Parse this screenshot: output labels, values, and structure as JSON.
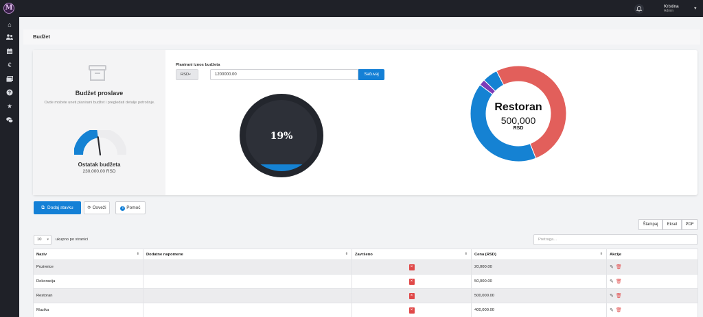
{
  "topbar": {
    "logo_letter": "M",
    "user_name": "Kristina",
    "user_role": "Admin"
  },
  "sidebar": {
    "items": [
      "home-icon",
      "users-icon",
      "calendar-icon",
      "euro-icon",
      "images-icon",
      "help-icon",
      "star-icon",
      "chat-icon"
    ]
  },
  "page": {
    "title": "Budžet"
  },
  "left": {
    "title": "Budžet proslave",
    "description": "Ovde možete uneti planirani budžet i pregledati detalje potrošnje.",
    "remaining_title": "Ostatak budžeta",
    "remaining_value": "230,000.00 RSD",
    "gauge_fraction": 0.46
  },
  "budget_form": {
    "label": "Planirani iznos budžeta",
    "currency": "RSD",
    "amount": "1200000.00",
    "save_label": "Sačuvaj"
  },
  "tank": {
    "percent_label": "19%",
    "fill_fraction": 0.19
  },
  "donut": {
    "center_name": "Restoran",
    "center_value": "500,000",
    "center_unit": "RSD",
    "segments": [
      {
        "name": "Pozivnice",
        "value": 20000,
        "color": "#7e3bb8"
      },
      {
        "name": "Dekoracija",
        "value": 50000,
        "color": "#1582d3"
      },
      {
        "name": "Restoran",
        "value": 500000,
        "color": "#e25f5b"
      },
      {
        "name": "Muzika",
        "value": 400000,
        "color": "#1582d3"
      }
    ]
  },
  "actions": {
    "add_label": "Dodaj stavku",
    "refresh_label": "Osveži",
    "help_label": "Pomoć"
  },
  "export": {
    "print": "Štampaj",
    "excel": "Eksel",
    "pdf": "PDF"
  },
  "table_controls": {
    "page_length": "10",
    "page_length_label": "ukupno po stranici",
    "search_placeholder": "Pretraga..."
  },
  "table": {
    "headers": [
      "Naziv",
      "Dodatne napomene",
      "Završeno",
      "Cena (RSD)",
      "Akcije"
    ],
    "rows": [
      {
        "naziv": "Pozivnice",
        "napomene": "",
        "cena": "20,000.00"
      },
      {
        "naziv": "Dekoracija",
        "napomene": "",
        "cena": "50,000.00"
      },
      {
        "naziv": "Restoran",
        "napomene": "",
        "cena": "500,000.00"
      },
      {
        "naziv": "Muzika",
        "napomene": "",
        "cena": "400,000.00"
      }
    ]
  }
}
